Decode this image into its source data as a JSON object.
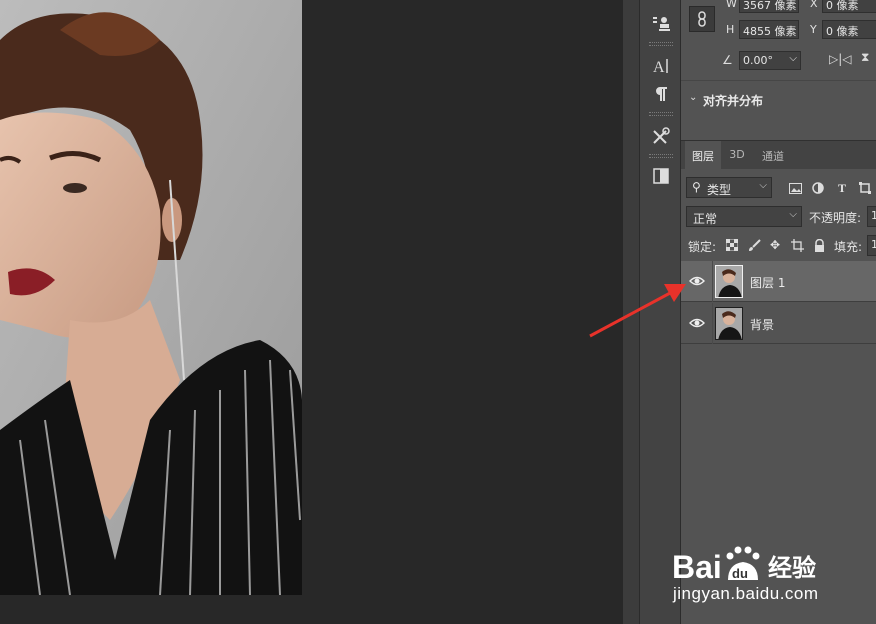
{
  "properties": {
    "w_label": "W",
    "w_value": "3567 像素",
    "x_label": "X",
    "x_value": "0 像素",
    "h_label": "H",
    "h_value": "4855 像素",
    "y_label": "Y",
    "y_value": "0 像素",
    "angle_value": "0.00°",
    "section_title": "对齐并分布"
  },
  "layers_panel": {
    "tabs": [
      "图层",
      "3D",
      "通道"
    ],
    "filter_label": "类型",
    "blend_mode": "正常",
    "opacity_label": "不透明度:",
    "opacity_value": "1",
    "lock_label": "锁定:",
    "fill_label": "填充:",
    "fill_value": "1",
    "layers": [
      {
        "name": "图层 1",
        "selected": true,
        "visible": true
      },
      {
        "name": "背景",
        "selected": false,
        "visible": true
      }
    ]
  },
  "watermark": {
    "brand_latin": "Bai",
    "brand_latin2": "du",
    "brand_cn": "经验",
    "url": "jingyan.baidu.com"
  },
  "colors": {
    "canvas_bg": "#282828",
    "panel_bg": "#535353",
    "selected_layer": "#676767",
    "arrow": "#e8322a"
  },
  "icons": [
    "stamp-icon",
    "character-icon",
    "paragraph-icon",
    "tools-icon",
    "book-icon",
    "link-icon",
    "eye-icon",
    "search-icon"
  ]
}
